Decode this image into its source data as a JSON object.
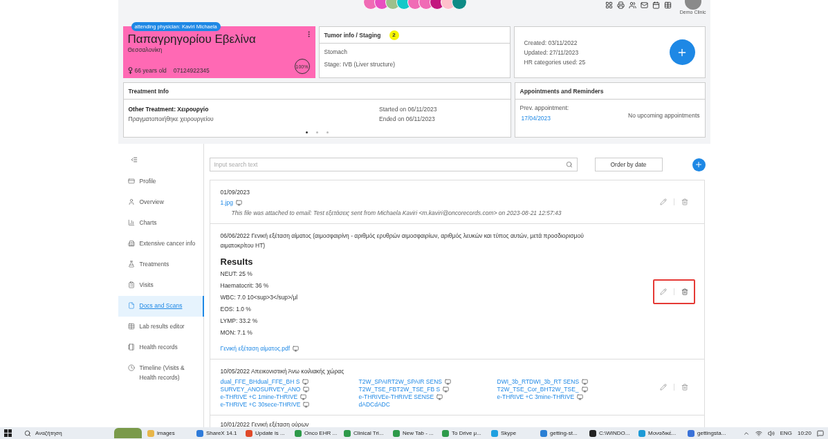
{
  "header": {
    "avatars": [
      {
        "color": "#f06bb5"
      },
      {
        "color": "#e84ec0"
      },
      {
        "color": "#9dc08b"
      },
      {
        "color": "#14c8c8"
      },
      {
        "color": "#f06bb5"
      },
      {
        "color": "#f06bb5"
      },
      {
        "color": "#c2177f"
      },
      {
        "color": "#ffc0cb"
      },
      {
        "color": "#0e8b86"
      }
    ],
    "clinic": "Demo Clinic"
  },
  "patient": {
    "attending": "attending physician: Kaviri Michaela",
    "name": "Παπαγρηγορίου Εβελίνα",
    "city": "Θεσσαλονίκη",
    "age": "66 years old",
    "phone": "07124922345",
    "completeness": "100%"
  },
  "tumor": {
    "title": "Tumor info / Staging",
    "badge": "2",
    "site": "Stomach",
    "stage": "Stage: IVB (Liver structure)"
  },
  "stats": {
    "created": "Created: 03/11/2022",
    "updated": "Updated: 27/11/2023",
    "categories": "HR categories used: 25"
  },
  "treatment": {
    "title": "Treatment Info",
    "name": "Other Treatment: Χειρουργίο",
    "description": "Πραγματοποιήθηκε χειρουργείου",
    "started": "Started on 06/11/2023",
    "ended": "Ended on 06/11/2023",
    "pages": [
      {
        "selected": true
      },
      {
        "selected": false
      },
      {
        "selected": false
      }
    ]
  },
  "appointments": {
    "title": "Appointments and Reminders",
    "prev_label": "Prev. appointment:",
    "prev_date": "17/04/2023",
    "upcoming": "No upcoming appointments"
  },
  "sidebar": {
    "items": [
      {
        "kind": "profile",
        "label": "Profile",
        "selected": false
      },
      {
        "kind": "overview",
        "label": "Overview",
        "selected": false
      },
      {
        "kind": "charts",
        "label": "Charts",
        "selected": false
      },
      {
        "kind": "cancer",
        "label": "Extensive cancer info",
        "selected": false
      },
      {
        "kind": "treatments",
        "label": "Treatments",
        "selected": false
      },
      {
        "kind": "visits",
        "label": "Visits",
        "selected": false
      },
      {
        "kind": "docs",
        "label": "Docs and Scans",
        "selected": true
      },
      {
        "kind": "lab",
        "label": "Lab results editor",
        "selected": false
      },
      {
        "kind": "records",
        "label": "Health records",
        "selected": false
      },
      {
        "kind": "timeline",
        "label": "Timeline (Visits & Health records)",
        "selected": false
      }
    ]
  },
  "docs": {
    "search": {
      "placeholder": "Input search text"
    },
    "order_button": "Order by date",
    "items": [
      {
        "kind": "attachment",
        "title": "01/09/2023",
        "files": [
          {
            "name": "1.jpg",
            "preview": true
          }
        ],
        "note": "This file was attached to email: Test εξετάσεις sent from Michaela Kaviri <m.kaviri@oncorecords.com> on 2023-08-21 12:57:43"
      },
      {
        "kind": "results",
        "title": "06/06/2022 Γενική εξέταση αίματος (αιμοσφαιρίνη - αριθμός ερυθρών αιμοσφαιρίων, αριθμός λευκών και τύπος αυτών, μετά προσδιορισμού αιματοκρίτου HT)",
        "highlighted": true,
        "heading": "Results",
        "results": [
          "NEUT: 25 %",
          "Haematocrit: 36 %",
          "WBC: 7.0 10<sup>3</sup>/μl",
          "EOS: 1.0 %",
          "LYMP: 33.2 %",
          "MON: 7.1 %"
        ],
        "files": [
          {
            "name": "Γενική εξέταση αίματος.pdf",
            "preview": true
          }
        ]
      },
      {
        "kind": "scans",
        "title": "10/05/2022 Απεικονιστική Άνω κοιλιακής χώρας",
        "files": [
          {
            "name": "dual_FFE_BHdual_FFE_BH S",
            "preview": true
          },
          {
            "name": "T2W_SPAIRT2W_SPAIR SENS",
            "preview": true
          },
          {
            "name": "DWI_3b_RTDWI_3b_RT SENS",
            "preview": true
          },
          {
            "name": "SURVEY_ANOSURVEY_ANO",
            "preview": true
          },
          {
            "name": "T2W_TSE_FBT2W_TSE_FB S",
            "preview": true
          },
          {
            "name": "T2W_TSE_Cor_BHT2W_TSE_",
            "preview": true
          },
          {
            "name": "e-THRIVE +C 1mine-THRIVE",
            "preview": true
          },
          {
            "name": "e-THRIVEe-THRIVE SENSE",
            "preview": true
          },
          {
            "name": "e-THRIVE +C 3mine-THRIVE",
            "preview": true
          },
          {
            "name": "e-THRIVE +C 30sece-THRIVE",
            "preview": true
          },
          {
            "name": "dADCdADC",
            "preview": false
          }
        ]
      },
      {
        "kind": "cut",
        "title": "10/01/2022 Γενική εξέταση ούρων"
      }
    ]
  },
  "taskbar": {
    "search": "Αναζήτηση",
    "apps": [
      {
        "label": "images",
        "color": "#e8b64a"
      },
      {
        "label": "ShareX 14.1",
        "color": "#2f7bd9"
      },
      {
        "label": "Update is ...",
        "color": "#e04a2a"
      },
      {
        "label": "Onco EHR ...",
        "color": "#2e9a4a"
      },
      {
        "label": "Clinical Tri...",
        "color": "#2e9a4a"
      },
      {
        "label": "New Tab - ...",
        "color": "#2e9a4a"
      },
      {
        "label": "To Drive μ...",
        "color": "#2e9a4a"
      },
      {
        "label": "Skype",
        "color": "#1fa0e0"
      },
      {
        "label": "getting-st...",
        "color": "#2a7fd4"
      },
      {
        "label": "C:\\WINDO...",
        "color": "#222222"
      },
      {
        "label": "Μοναδικέ...",
        "color": "#1d9ad6"
      },
      {
        "label": "gettingsta...",
        "color": "#3a72d8"
      }
    ],
    "language": "ENG",
    "time": "10:20"
  }
}
